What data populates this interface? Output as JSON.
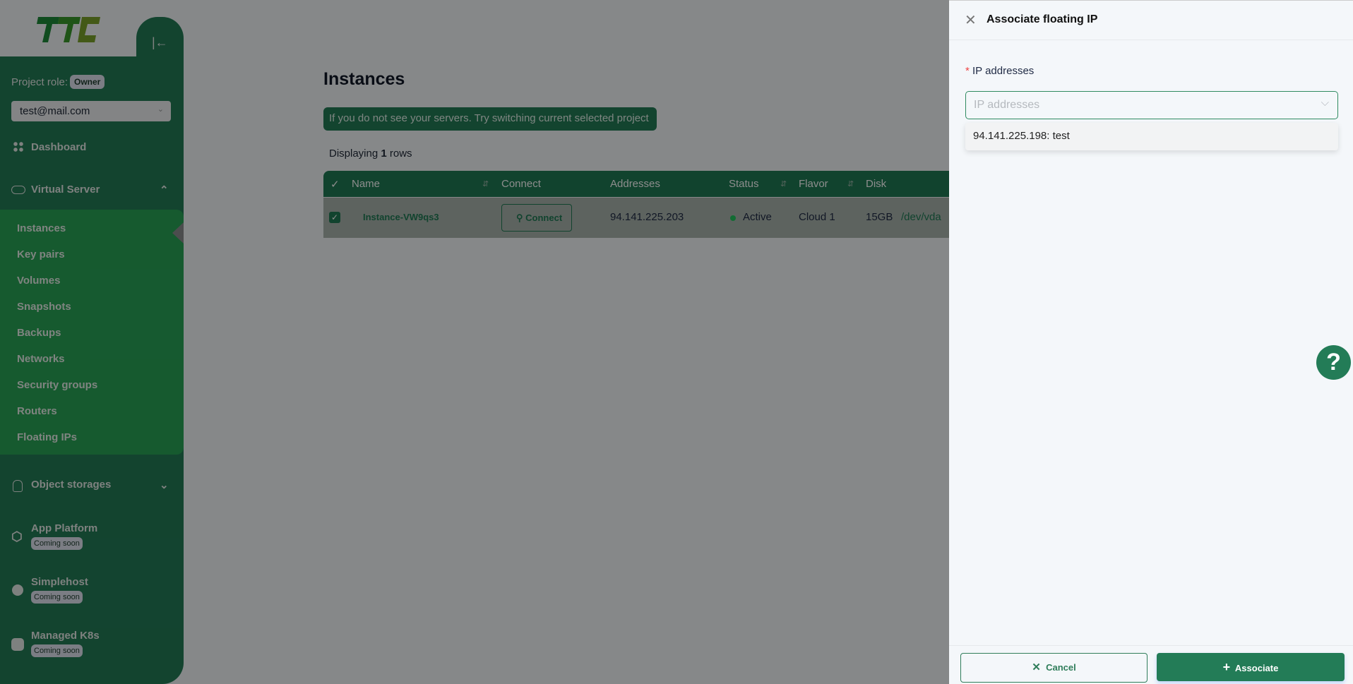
{
  "sidebar": {
    "logo_text": "TTC",
    "project_role_label": "Project role:",
    "project_role": "Owner",
    "account": "test@mail.com",
    "dashboard": "Dashboard",
    "virtual_server": "Virtual Server",
    "sub_items": [
      "Instances",
      "Key pairs",
      "Volumes",
      "Snapshots",
      "Backups",
      "Networks",
      "Security groups",
      "Routers",
      "Floating IPs"
    ],
    "object_storages": "Object storages",
    "app_platform": "App Platform",
    "simplehost": "Simplehost",
    "managed_k8s": "Managed K8s",
    "coming_soon": "Coming soon"
  },
  "main": {
    "title": "Instances",
    "alert": "If you do not see your servers. Try switching current selected project",
    "displaying_prefix": "Displaying",
    "row_count": "1",
    "displaying_suffix": "rows",
    "columns": [
      "Name",
      "Connect",
      "Addresses",
      "Status",
      "Flavor",
      "Disk"
    ],
    "rows": [
      {
        "name": "Instance-VW9qs3",
        "connect": "Connect",
        "address": "94.141.225.203",
        "status": "Active",
        "flavor": "Cloud 1",
        "disk_size": "15GB",
        "disk_dev": "/dev/vda",
        "selected": true
      }
    ]
  },
  "drawer": {
    "title": "Associate floating IP",
    "required_mark": "*",
    "field_label": "IP addresses",
    "placeholder": "IP addresses",
    "options": [
      "94.141.225.198: test"
    ],
    "cancel": "Cancel",
    "associate": "Associate"
  },
  "help": "?",
  "colors": {
    "brand": "#237c57",
    "status_active": "#22c55e",
    "required": "#ef4444"
  }
}
